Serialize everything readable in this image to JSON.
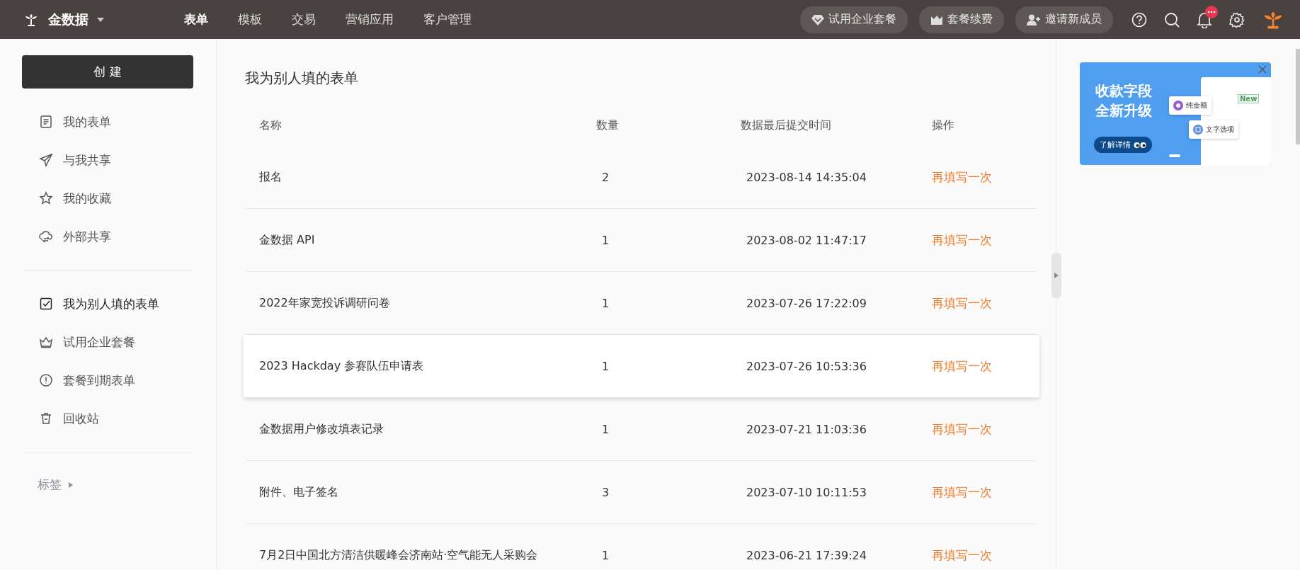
{
  "topbar": {
    "brand": "金数据",
    "nav": [
      {
        "label": "表单",
        "selected": true
      },
      {
        "label": "模板",
        "selected": false
      },
      {
        "label": "交易",
        "selected": false
      },
      {
        "label": "营销应用",
        "selected": false
      },
      {
        "label": "客户管理",
        "selected": false
      }
    ],
    "actions": [
      {
        "kind": "diamond",
        "label": "试用企业套餐"
      },
      {
        "kind": "crown",
        "label": "套餐续费"
      },
      {
        "kind": "invite",
        "label": "邀请新成员"
      }
    ]
  },
  "sidebar": {
    "create_button": "创 建",
    "groups": [
      [
        {
          "kind": "document",
          "label": "我的表单",
          "selected": false
        },
        {
          "kind": "send",
          "label": "与我共享",
          "selected": false
        },
        {
          "kind": "star",
          "label": "我的收藏",
          "selected": false
        },
        {
          "kind": "cloud",
          "label": "外部共享",
          "selected": false
        }
      ],
      [
        {
          "kind": "checkbox",
          "label": "我为别人填的表单",
          "selected": true
        },
        {
          "kind": "crown",
          "label": "试用企业套餐",
          "selected": false
        },
        {
          "kind": "alert",
          "label": "套餐到期表单",
          "selected": false
        },
        {
          "kind": "trash",
          "label": "回收站",
          "selected": false
        }
      ]
    ],
    "tags_label": "标签"
  },
  "main": {
    "title": "我为别人填的表单",
    "columns": [
      "名称",
      "数量",
      "数据最后提交时间",
      "操作"
    ],
    "rows": [
      {
        "name": "报名",
        "count": "2",
        "time": "2023-08-14 14:35:04",
        "action": "再填写一次",
        "highlighted": false
      },
      {
        "name": "金数据 API",
        "count": "1",
        "time": "2023-08-02 11:47:17",
        "action": "再填写一次",
        "highlighted": false
      },
      {
        "name": "2022年家宽投诉调研问卷",
        "count": "1",
        "time": "2023-07-26 17:22:09",
        "action": "再填写一次",
        "highlighted": false
      },
      {
        "name": "2023 Hackday 参赛队伍申请表",
        "count": "1",
        "time": "2023-07-26 10:53:36",
        "action": "再填写一次",
        "highlighted": true
      },
      {
        "name": "金数据用户修改填表记录",
        "count": "1",
        "time": "2023-07-21 11:03:36",
        "action": "再填写一次",
        "highlighted": false
      },
      {
        "name": "附件、电子签名",
        "count": "3",
        "time": "2023-07-10 10:11:53",
        "action": "再填写一次",
        "highlighted": false
      },
      {
        "name": "7月2日中国北方清洁供暖峰会济南站·空气能无人采购会",
        "count": "1",
        "time": "2023-06-21 17:39:24",
        "action": "再填写一次",
        "highlighted": false
      }
    ]
  },
  "banner": {
    "headline": [
      "收款字段",
      "全新升级"
    ],
    "button": "了解详情",
    "new_tag": "New",
    "options": [
      {
        "kind": "amount",
        "label": "纯金额"
      },
      {
        "kind": "text",
        "label": "文字选项"
      }
    ]
  }
}
